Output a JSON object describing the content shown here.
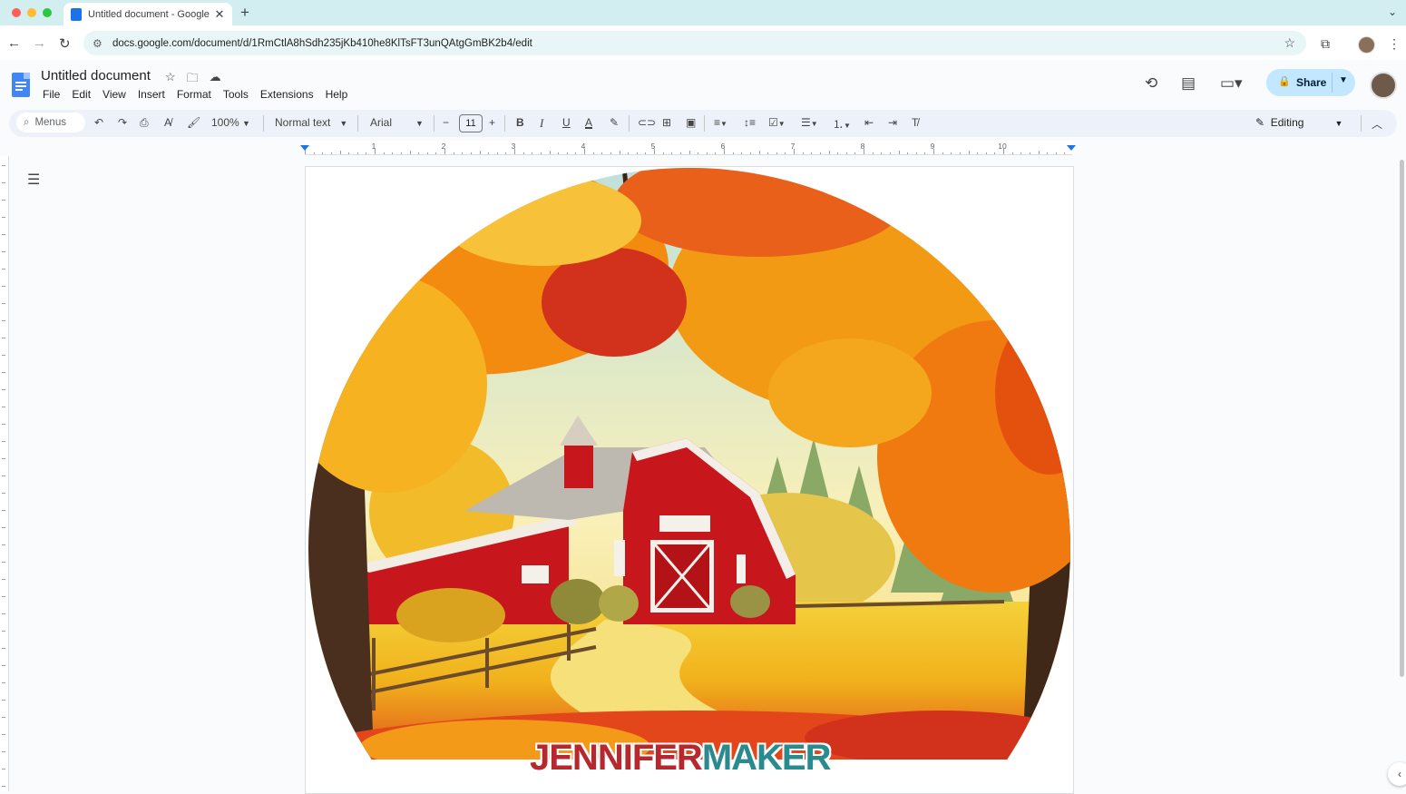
{
  "browser": {
    "tab_title": "Untitled document - Google D",
    "url": "docs.google.com/document/d/1RmCtlA8hSdh235jKb410he8KlTsFT3unQAtgGmBK2b4/edit",
    "traffic_colors": [
      "#ff5f57",
      "#febc2e",
      "#28c840"
    ]
  },
  "doc": {
    "title": "Untitled document",
    "menus": [
      "File",
      "Edit",
      "View",
      "Insert",
      "Format",
      "Tools",
      "Extensions",
      "Help"
    ],
    "share_label": "Share"
  },
  "toolbar": {
    "search_placeholder": "Menus",
    "zoom": "100%",
    "style": "Normal text",
    "font": "Arial",
    "font_size": "11",
    "mode": "Editing"
  },
  "ruler": {
    "numbers": [
      "1",
      "2",
      "3",
      "4",
      "5",
      "6",
      "7",
      "8",
      "9",
      "10"
    ]
  },
  "image": {
    "subject": "red barn in autumn forest, circular illustration",
    "watermark_part1": "JENNIFER",
    "watermark_part2": "MAKER"
  },
  "colors": {
    "accent": "#1a73e8",
    "share_bg": "#c2e7ff",
    "barn_red": "#c8161d",
    "foliage_orange": "#f08a12"
  }
}
